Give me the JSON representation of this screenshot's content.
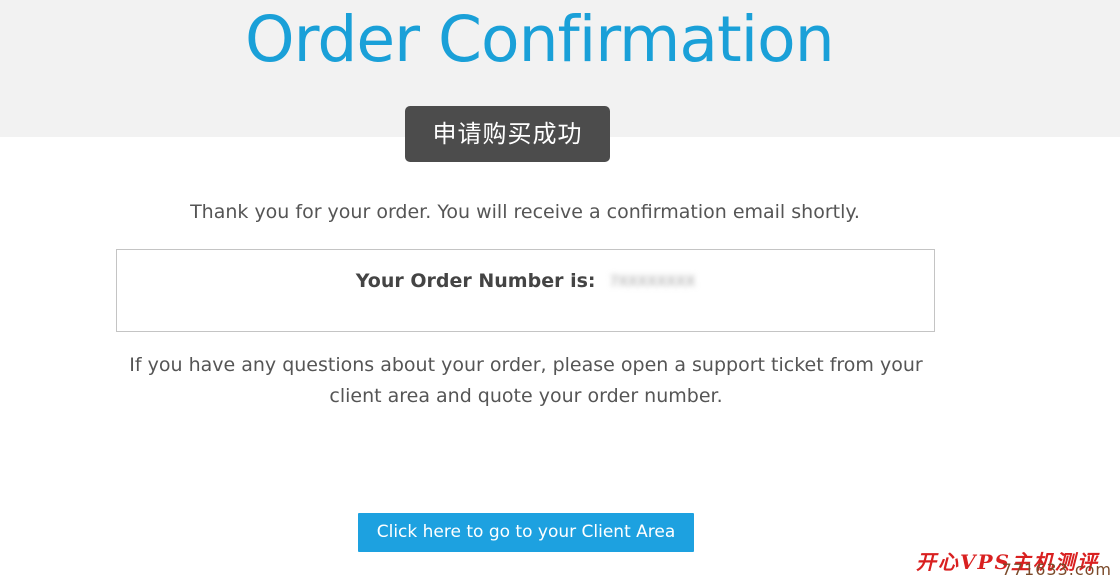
{
  "header": {
    "title": "Order Confirmation"
  },
  "toast": {
    "message": "申请购买成功"
  },
  "main": {
    "thanks_text": "Thank you for your order. You will receive a confirmation email shortly.",
    "order_label": "Your Order Number is:",
    "order_number": "7XXXXXXXX",
    "questions_text": "If you have any questions about your order, please open a support ticket from your client area and quote your order number.",
    "client_area_button": "Click here to go to your Client Area"
  },
  "watermark": {
    "text": "开心VPS主机测评",
    "url": "771633.com"
  },
  "colors": {
    "title": "#1aa0d8",
    "button": "#1da1e0",
    "header_band": "#f2f2f2",
    "toast_bg": "#4c4c4c"
  }
}
